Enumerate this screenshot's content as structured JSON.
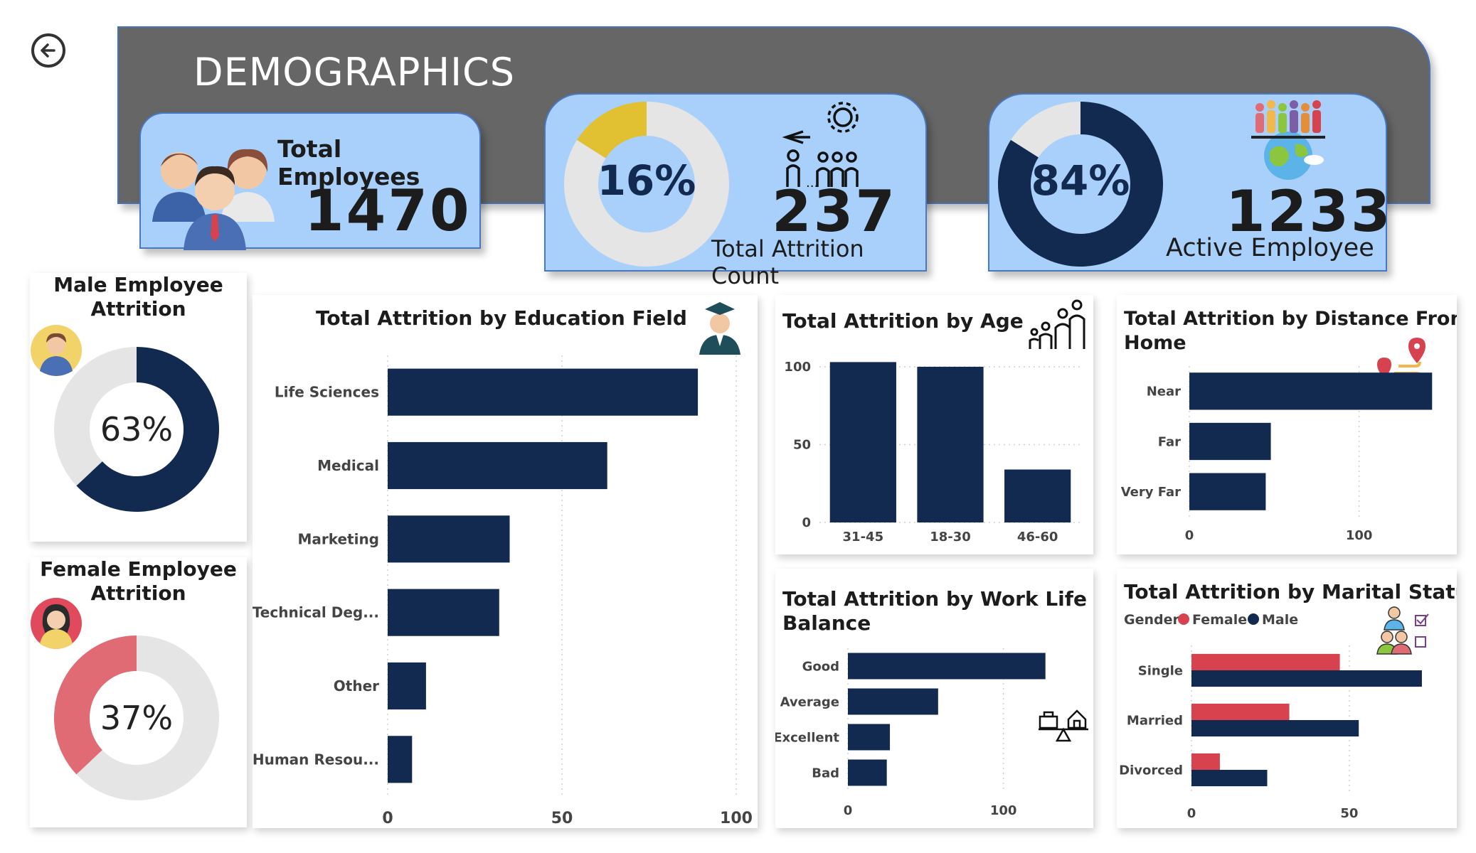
{
  "page_title": "DEMOGRAPHICS",
  "colors": {
    "navy": "#132a50",
    "light_grey": "#e5e5e5",
    "gold": "#e1c131",
    "pink": "#e06b74",
    "red": "#d7424f",
    "kpi_bg": "#a8d0fb",
    "banner": "#666666"
  },
  "kpis": {
    "total_employees": {
      "label": "Total Employees",
      "value": "1470",
      "icon": "people-group-icon"
    },
    "attrition": {
      "percent": "16%",
      "percent_value": 16,
      "value": "237",
      "label": "Total Attrition Count",
      "icon": "leaving-employee-icon"
    },
    "active": {
      "percent": "84%",
      "percent_value": 84,
      "value": "1233",
      "label": "Active Employee",
      "icon": "globe-people-icon"
    }
  },
  "male_attrition": {
    "title_line1": "Male Employee",
    "title_line2": "Attrition",
    "percent": "63%",
    "percent_value": 63
  },
  "female_attrition": {
    "title_line1": "Female Employee",
    "title_line2": "Attrition",
    "percent": "37%",
    "percent_value": 37
  },
  "chart_data": [
    {
      "id": "education",
      "type": "bar",
      "orientation": "horizontal",
      "title": "Total Attrition by Education Field",
      "categories": [
        "Life Sciences",
        "Medical",
        "Marketing",
        "Technical Deg...",
        "Other",
        "Human Resou..."
      ],
      "values": [
        89,
        63,
        35,
        32,
        11,
        7
      ],
      "xlim": [
        0,
        100
      ],
      "ticks": [
        "0",
        "50",
        "100"
      ],
      "tick_values": [
        0,
        50,
        100
      ],
      "grid": true
    },
    {
      "id": "age",
      "type": "bar",
      "orientation": "vertical",
      "title": "Total Attrition by Age",
      "categories": [
        "31-45",
        "18-30",
        "46-60"
      ],
      "values": [
        103,
        100,
        34
      ],
      "ylim": [
        0,
        105
      ],
      "ticks": [
        "0",
        "50",
        "100"
      ],
      "tick_values": [
        0,
        50,
        100
      ],
      "grid": true
    },
    {
      "id": "distance",
      "type": "bar",
      "orientation": "horizontal",
      "title_line1": "Total Attrition by Distance From",
      "title_line2": "Home",
      "categories": [
        "Near",
        "Far",
        "Very Far"
      ],
      "values": [
        143,
        48,
        45
      ],
      "xlim": [
        0,
        150
      ],
      "ticks": [
        "0",
        "100"
      ],
      "tick_values": [
        0,
        100
      ],
      "grid": true
    },
    {
      "id": "worklife",
      "type": "bar",
      "orientation": "horizontal",
      "title_line1": "Total Attrition by Work Life",
      "title_line2": "Balance",
      "categories": [
        "Good",
        "Average",
        "Excellent",
        "Bad"
      ],
      "values": [
        127,
        58,
        27,
        25
      ],
      "xlim": [
        0,
        150
      ],
      "ticks": [
        "0",
        "100"
      ],
      "tick_values": [
        0,
        100
      ],
      "grid": true
    },
    {
      "id": "marital",
      "type": "bar",
      "orientation": "horizontal",
      "title": "Total Attrition by Marital Status",
      "legend_title": "Gender",
      "categories": [
        "Single",
        "Married",
        "Divorced"
      ],
      "series": [
        {
          "name": "Female",
          "color": "#d7424f",
          "values": [
            47,
            31,
            9
          ]
        },
        {
          "name": "Male",
          "color": "#132a50",
          "values": [
            73,
            53,
            24
          ]
        }
      ],
      "xlim": [
        0,
        80
      ],
      "ticks": [
        "0",
        "50"
      ],
      "tick_values": [
        0,
        50
      ],
      "grid": true
    }
  ]
}
